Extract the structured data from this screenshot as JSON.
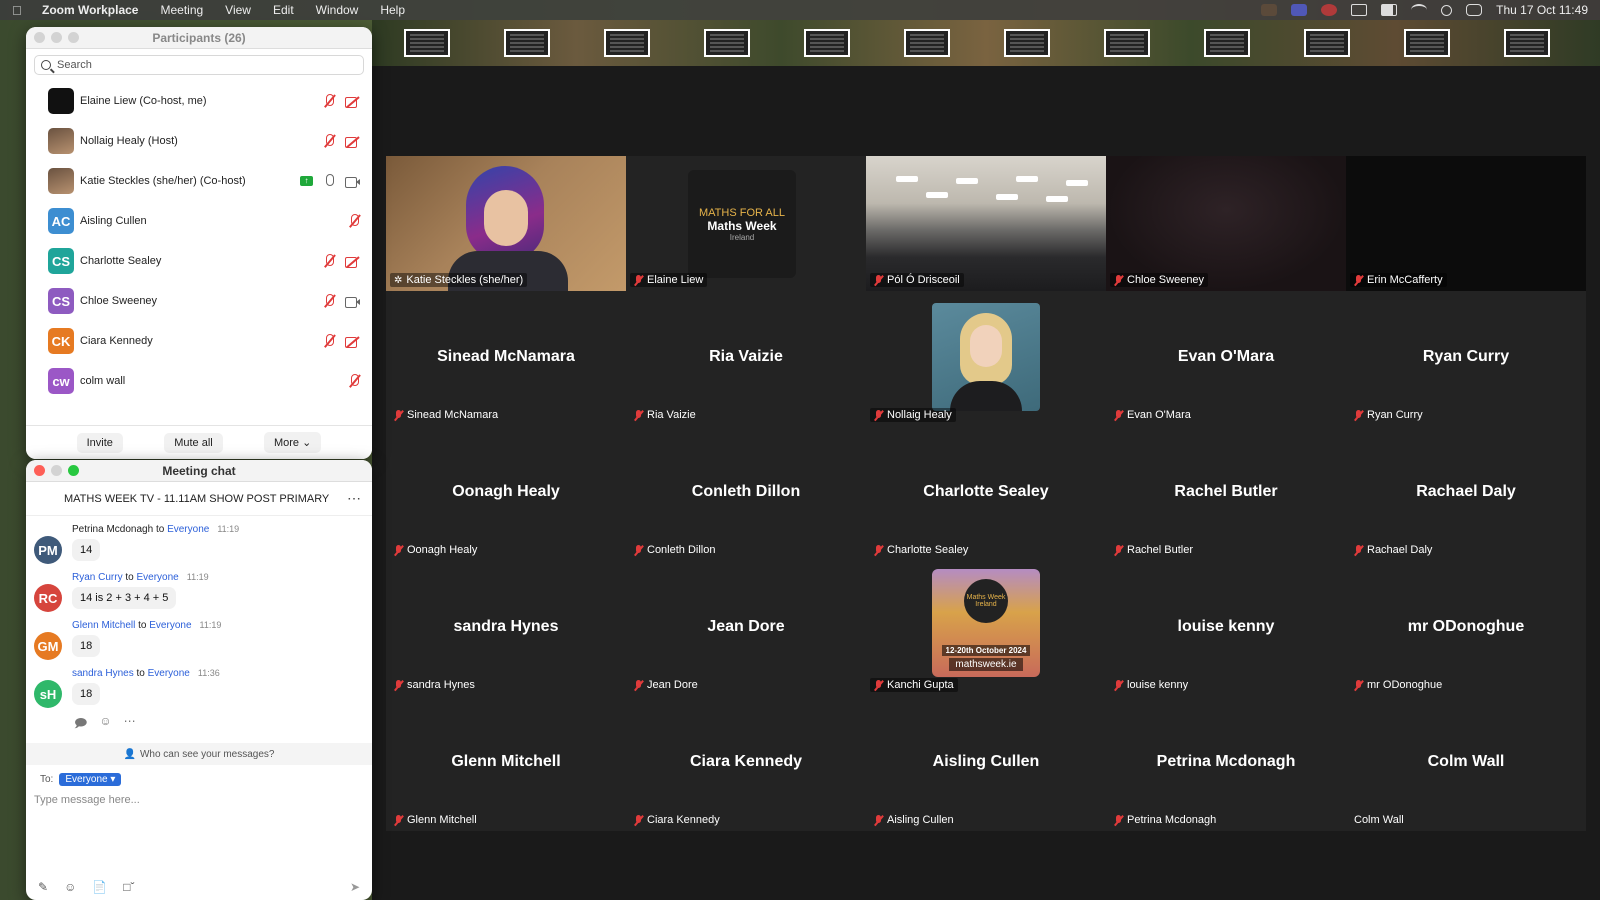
{
  "menubar": {
    "app": "Zoom Workplace",
    "menus": [
      "Meeting",
      "View",
      "Edit",
      "Window",
      "Help"
    ],
    "clock": "Thu 17 Oct  11:49"
  },
  "participants_window": {
    "title": "Participants (26)",
    "search_placeholder": "Search",
    "rows": [
      {
        "name": "Elaine Liew (Co-host, me)",
        "initials": "",
        "color": "#111111",
        "mic": "off",
        "cam": "off"
      },
      {
        "name": "Nollaig Healy (Host)",
        "initials": "",
        "color": "#8a6a50",
        "mic": "off",
        "cam": "off"
      },
      {
        "name": "Katie Steckles (she/her) (Co-host)",
        "initials": "",
        "color": "#8a6a50",
        "mic": "on",
        "cam": "on",
        "share": true
      },
      {
        "name": "Aisling Cullen",
        "initials": "AC",
        "color": "#3d8ed1",
        "mic": "off",
        "cam": "none"
      },
      {
        "name": "Charlotte Sealey",
        "initials": "CS",
        "color": "#1fa59a",
        "mic": "off",
        "cam": "off"
      },
      {
        "name": "Chloe Sweeney",
        "initials": "CS",
        "color": "#8e5bc0",
        "mic": "off",
        "cam": "on"
      },
      {
        "name": "Ciara Kennedy",
        "initials": "CK",
        "color": "#e67a22",
        "mic": "off",
        "cam": "off"
      },
      {
        "name": "colm wall",
        "initials": "cw",
        "color": "#9b57c6",
        "mic": "off",
        "cam": "none"
      }
    ],
    "buttons": {
      "invite": "Invite",
      "mute_all": "Mute all",
      "more": "More"
    }
  },
  "chat_window": {
    "title": "Meeting chat",
    "header": "MATHS WEEK TV - 11.11AM SHOW POST PRIMARY",
    "messages": [
      {
        "sender": "Petrina Mcdonagh",
        "to_word": "to",
        "to": "Everyone",
        "time": "11:19",
        "text": "14",
        "initials": "PM",
        "color": "#3f5a7a"
      },
      {
        "sender": "Ryan Curry",
        "to_word": "to",
        "to": "Everyone",
        "time": "11:19",
        "text": "14 is 2 + 3 + 4 + 5",
        "initials": "RC",
        "color": "#d6453d"
      },
      {
        "sender": "Glenn Mitchell",
        "to_word": "to",
        "to": "Everyone",
        "time": "11:19",
        "text": "18",
        "initials": "GM",
        "color": "#e67a22"
      },
      {
        "sender": "sandra Hynes",
        "to_word": "to",
        "to": "Everyone",
        "time": "11:36",
        "text": "18",
        "initials": "sH",
        "color": "#2fb86a"
      }
    ],
    "who_can_see": "Who can see your messages?",
    "to_label": "To:",
    "to_value": "Everyone",
    "input_placeholder": "Type message here..."
  },
  "gallery": {
    "tiles": [
      {
        "label": "Katie Steckles (she/her)",
        "center": "",
        "kind": "person",
        "active": true,
        "pin": true
      },
      {
        "label": "Elaine Liew",
        "center": "",
        "kind": "logo"
      },
      {
        "label": "Pól Ó Drisceoil",
        "center": "",
        "kind": "classroom"
      },
      {
        "label": "Chloe Sweeney",
        "center": "",
        "kind": "dark"
      },
      {
        "label": "Erin McCafferty",
        "center": "",
        "kind": "black"
      },
      {
        "label": "Sinead McNamara",
        "center": "Sinead McNamara",
        "kind": "name"
      },
      {
        "label": "Ria Vaizie",
        "center": "Ria Vaizie",
        "kind": "name"
      },
      {
        "label": "Nollaig Healy",
        "center": "",
        "kind": "portrait"
      },
      {
        "label": "Evan O'Mara",
        "center": "Evan O'Mara",
        "kind": "name"
      },
      {
        "label": "Ryan Curry",
        "center": "Ryan Curry",
        "kind": "name"
      },
      {
        "label": "Oonagh Healy",
        "center": "Oonagh Healy",
        "kind": "name"
      },
      {
        "label": "Conleth Dillon",
        "center": "Conleth Dillon",
        "kind": "name"
      },
      {
        "label": "Charlotte Sealey",
        "center": "Charlotte Sealey",
        "kind": "name"
      },
      {
        "label": "Rachel Butler",
        "center": "Rachel Butler",
        "kind": "name"
      },
      {
        "label": "Rachael Daly",
        "center": "Rachael Daly",
        "kind": "name"
      },
      {
        "label": "sandra Hynes",
        "center": "sandra Hynes",
        "kind": "name"
      },
      {
        "label": "Jean Dore",
        "center": "Jean Dore",
        "kind": "name"
      },
      {
        "label": "Kanchi Gupta",
        "center": "",
        "kind": "poster"
      },
      {
        "label": "louise kenny",
        "center": "louise kenny",
        "kind": "name"
      },
      {
        "label": "mr ODonoghue",
        "center": "mr ODonoghue",
        "kind": "name"
      },
      {
        "label": "Glenn Mitchell",
        "center": "Glenn Mitchell",
        "kind": "name"
      },
      {
        "label": "Ciara Kennedy",
        "center": "Ciara Kennedy",
        "kind": "name"
      },
      {
        "label": "Aisling Cullen",
        "center": "Aisling Cullen",
        "kind": "name"
      },
      {
        "label": "Petrina Mcdonagh",
        "center": "Petrina Mcdonagh",
        "kind": "name"
      },
      {
        "label": "Colm Wall",
        "center": "Colm Wall",
        "kind": "name",
        "unmuted": true
      }
    ],
    "logo_text": {
      "line1": "MATHS FOR ALL",
      "line2": "Maths Week",
      "line3": "Ireland"
    },
    "poster_text": {
      "badge": "Maths Week Ireland",
      "dates": "12-20th October 2024",
      "url": "mathsweek.ie"
    }
  },
  "colors": {
    "active_border": "#2bd94a",
    "muted_red": "#e03b3b",
    "link_blue": "#2b5fd9"
  }
}
